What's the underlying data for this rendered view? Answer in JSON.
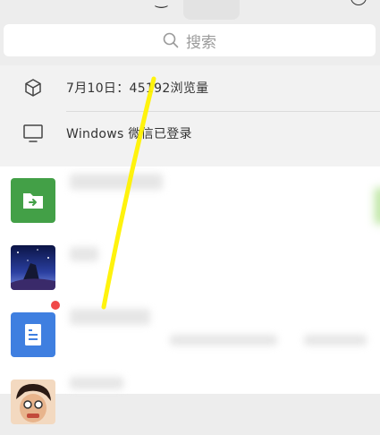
{
  "search": {
    "placeholder": "搜索"
  },
  "notices": [
    {
      "icon": "cube-icon",
      "text": "7月10日：45192浏览量"
    },
    {
      "icon": "monitor-icon",
      "text": "Windows 微信已登录"
    }
  ],
  "chats": [
    {
      "avatar": "folder-transfer-icon",
      "unread": false
    },
    {
      "avatar": "anime-photo",
      "unread": false
    },
    {
      "avatar": "document-icon",
      "unread": true
    },
    {
      "avatar": "cartoon-face",
      "unread": false
    }
  ],
  "colors": {
    "background": "#ededed",
    "accent_green": "#43a047",
    "doc_blue": "#3f7fe0",
    "badge_red": "#f04848",
    "annotation_yellow": "#fff200"
  }
}
